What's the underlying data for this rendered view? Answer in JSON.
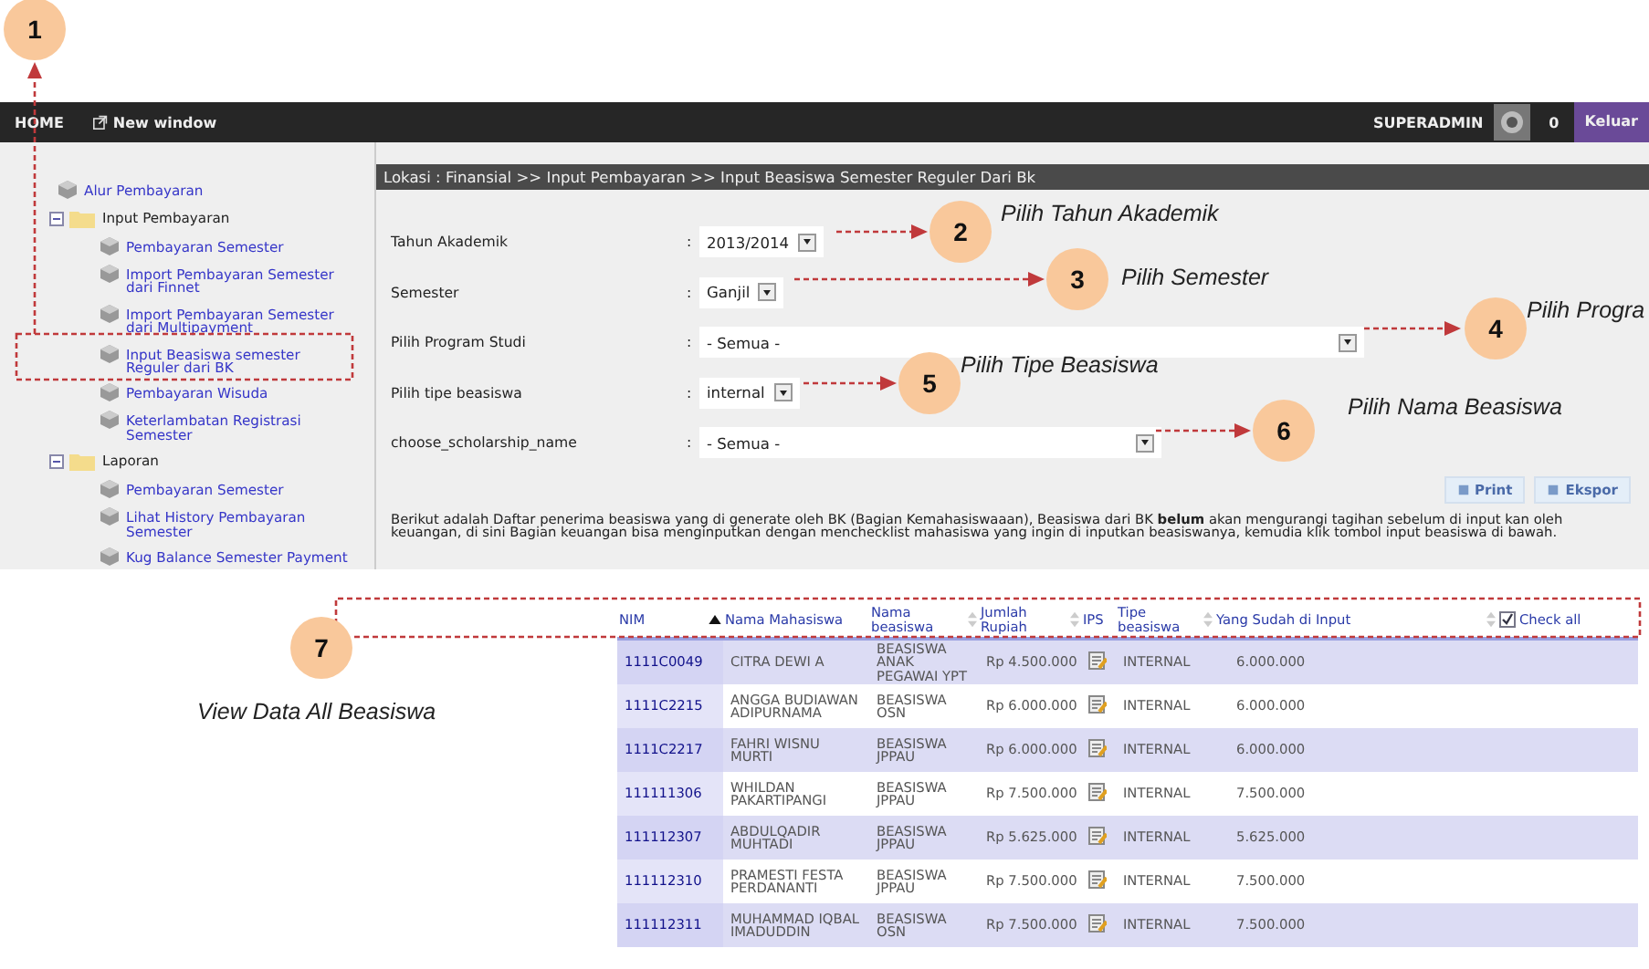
{
  "navbar": {
    "home": "HOME",
    "new_window": "New window",
    "user": "SUPERADMIN",
    "count": "0",
    "logout": "Keluar"
  },
  "sidebar": {
    "items": [
      {
        "label": "Alur Pembayaran"
      },
      {
        "label": "Input Pembayaran",
        "expanded": true,
        "children": [
          {
            "label": "Pembayaran Semester"
          },
          {
            "label": "Import Pembayaran Semester dari Finnet"
          },
          {
            "label": "Import Pembayaran Semester dari Multipayment"
          },
          {
            "label": "Input Beasiswa semester Reguler dari BK"
          },
          {
            "label": "Pembayaran Wisuda"
          },
          {
            "label": "Keterlambatan Registrasi Semester"
          }
        ]
      },
      {
        "label": "Laporan",
        "expanded": true,
        "children": [
          {
            "label": "Pembayaran Semester"
          },
          {
            "label": "Lihat History Pembayaran Semester"
          },
          {
            "label": "Kug Balance Semester Payment"
          }
        ]
      }
    ]
  },
  "breadcrumb": "Lokasi : Finansial >> Input Pembayaran >> Input Beasiswa Semester Reguler Dari Bk",
  "form": [
    {
      "label": "Tahun Akademik",
      "separator": ":",
      "value": "2013/2014"
    },
    {
      "label": "Semester",
      "separator": ":",
      "value": "Ganjil"
    },
    {
      "label": "Pilih Program Studi",
      "separator": ":",
      "value": "- Semua -"
    },
    {
      "label": "Pilih tipe beasiswa",
      "separator": ":",
      "value": "internal"
    },
    {
      "label": "choose_scholarship_name",
      "separator": ":",
      "value": "- Semua -"
    }
  ],
  "buttons": [
    "Print",
    "Ekspor"
  ],
  "note": "Berikut adalah Daftar penerima beasiswa yang di generate oleh BK (Bagian Kemahasiswaaan), Beasiswa dari BK **belum** akan mengurangi tagihan sebelum di input kan oleh keuangan, di sini Bagian keuangan bisa menginputkan dengan menchecklist mahasiswa yang ingin di inputkan beasiswanya, kemudia klik tombol input beasiswa di bawah.",
  "table": {
    "columns": [
      {
        "label": "NIM",
        "sorted": true,
        "sortable": false
      },
      {
        "label": "Nama Mahasiswa",
        "sorted": false,
        "sortable": false
      },
      {
        "label": "Nama beasiswa",
        "sorted": false,
        "sortable": true
      },
      {
        "label": "Jumlah Rupiah",
        "sorted": false,
        "sortable": true
      },
      {
        "label": "IPS",
        "sorted": false,
        "sortable": false
      },
      {
        "label": "Tipe beasiswa",
        "sorted": false,
        "sortable": true
      },
      {
        "label": "Yang Sudah di Input",
        "sorted": false,
        "sortable": true
      },
      {
        "label": "Check all",
        "sorted": false,
        "sortable": false,
        "kind": "checkbox",
        "checked": true
      }
    ],
    "rows": [
      {
        "nim": "1111C0049",
        "name": "CITRA DEWI A",
        "scholarship": "BEASISWA ANAK PEGAWAI YPT",
        "amount": "Rp 4.500.000",
        "type": "INTERNAL",
        "paid": "6.000.000"
      },
      {
        "nim": "1111C2215",
        "name": "ANGGA BUDIAWAN ADIPURNAMA",
        "scholarship": "BEASISWA OSN",
        "amount": "Rp 6.000.000",
        "type": "INTERNAL",
        "paid": "6.000.000"
      },
      {
        "nim": "1111C2217",
        "name": "FAHRI WISNU MURTI",
        "scholarship": "BEASISWA JPPAU",
        "amount": "Rp 6.000.000",
        "type": "INTERNAL",
        "paid": "6.000.000"
      },
      {
        "nim": "111111306",
        "name": "WHILDAN PAKARTIPANGI",
        "scholarship": "BEASISWA JPPAU",
        "amount": "Rp 7.500.000",
        "type": "INTERNAL",
        "paid": "7.500.000"
      },
      {
        "nim": "111112307",
        "name": "ABDULQADIR MUHTADI",
        "scholarship": "BEASISWA JPPAU",
        "amount": "Rp 5.625.000",
        "type": "INTERNAL",
        "paid": "5.625.000"
      },
      {
        "nim": "111112310",
        "name": "PRAMESTI FESTA PERDANANTI",
        "scholarship": "BEASISWA JPPAU",
        "amount": "Rp 7.500.000",
        "type": "INTERNAL",
        "paid": "7.500.000"
      },
      {
        "nim": "111112311",
        "name": "MUHAMMAD IQBAL IMADUDDIN",
        "scholarship": "BEASISWA OSN",
        "amount": "Rp 7.500.000",
        "type": "INTERNAL",
        "paid": "7.500.000"
      }
    ]
  },
  "annotations": [
    {
      "number": "1"
    },
    {
      "number": "2",
      "label": "Pilih Tahun Akademik"
    },
    {
      "number": "3",
      "label": "Pilih Semester"
    },
    {
      "number": "4",
      "label": "Pilih Progra"
    },
    {
      "number": "5",
      "label": "Pilih Tipe Beasiswa"
    },
    {
      "number": "6",
      "label": "Pilih Nama Beasiswa"
    },
    {
      "number": "7",
      "label": "View Data All Beasiswa"
    }
  ]
}
